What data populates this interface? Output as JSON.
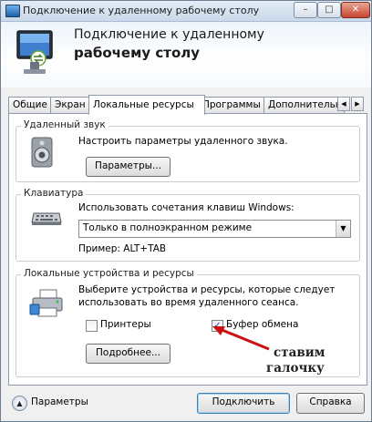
{
  "window": {
    "title": "Подключение к удаленному рабочему столу",
    "banner_line1": "Подключение к удаленному",
    "banner_line2": "рабочему столу",
    "minimize_glyph": "–",
    "maximize_glyph": "□",
    "close_glyph": "✕"
  },
  "tabs": [
    {
      "label": "Общие"
    },
    {
      "label": "Экран"
    },
    {
      "label": "Локальные ресурсы",
      "active": true
    },
    {
      "label": "Программы"
    },
    {
      "label": "Дополнительно"
    }
  ],
  "tab_scroll": {
    "left_glyph": "◀",
    "right_glyph": "▶"
  },
  "remote_audio": {
    "title": "Удаленный звук",
    "description": "Настроить параметры удаленного звука.",
    "button": "Параметры..."
  },
  "keyboard": {
    "title": "Клавиатура",
    "description": "Использовать сочетания клавиш Windows:",
    "selected_option": "Только в полноэкранном режиме",
    "example": "Пример: ALT+TAB"
  },
  "local_devices": {
    "title": "Локальные устройства и ресурсы",
    "description_line1": "Выберите устройства и ресурсы, которые следует",
    "description_line2": "использовать во время удаленного сеанса.",
    "printers_label": "Принтеры",
    "printers_checked": false,
    "clipboard_label": "Буфер обмена",
    "clipboard_checked": true,
    "more_button": "Подробнее..."
  },
  "annotation": {
    "line1": "ставим",
    "line2": "галочку",
    "arrow_color": "#cc1111"
  },
  "footer": {
    "options_label": "Параметры",
    "connect_button": "Подключить",
    "help_button": "Справка"
  }
}
